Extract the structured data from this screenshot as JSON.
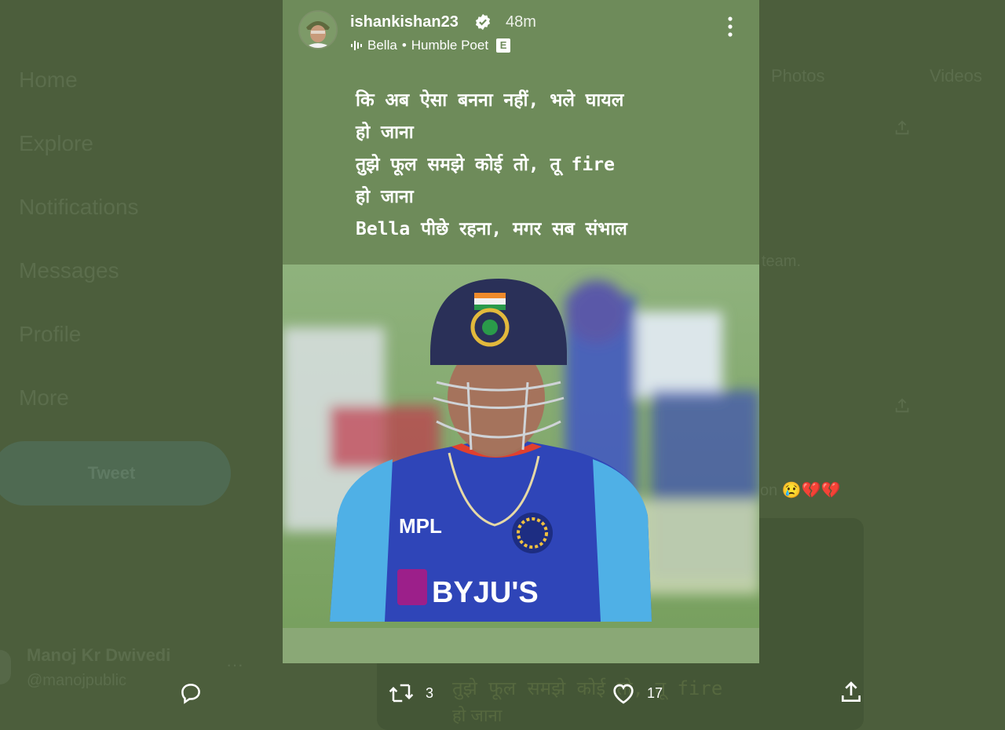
{
  "background": {
    "nav": [
      "Home",
      "Explore",
      "Notifications",
      "Messages",
      "Profile",
      "More"
    ],
    "tweet_button": "Tweet",
    "account": {
      "name": "Manoj Kr Dwivedi",
      "handle": "@manojpublic",
      "more": "···"
    },
    "tabs": [
      "Photos",
      "Videos"
    ],
    "right_snippets": {
      "team": "team.",
      "reaction": "on 😢💔💔",
      "ghost_line": "तुझे फूल समझे कोई तो, तू fire",
      "ghost_line2": "हो जाना"
    }
  },
  "story": {
    "username": "ishankishan23",
    "time": "48m",
    "music_title": "Bella",
    "music_sep": "•",
    "music_artist": "Humble Poet",
    "explicit_badge": "E",
    "lyrics": "कि अब ऐसा बनना नहीं, भले घायल\nहो जाना\nतुझे फूल समझे कोई तो, तू fire\nहो जाना\nBella पीछे रहना, मगर सब संभाल",
    "photo_text": {
      "sponsor": "BYJU'S",
      "kit": "MPL"
    }
  },
  "actions": {
    "retweet_count": "3",
    "like_count": "17"
  },
  "colors": {
    "story_bg": "#6e8b5a",
    "page_overlay": "#4c5e3c",
    "jersey_blue": "#2f45b8",
    "jersey_light": "#4fb0e6",
    "helmet": "#2a3058"
  }
}
